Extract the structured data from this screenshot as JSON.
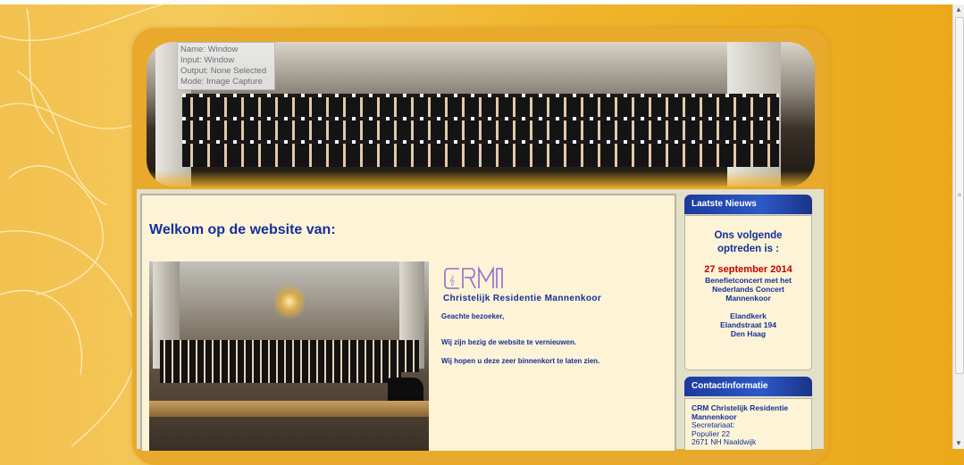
{
  "tooltip": {
    "name": "Name: Window",
    "input": "Input: Window",
    "output": "Output: None Selected",
    "mode": "Mode: Image Capture"
  },
  "main": {
    "welcome": "Welkom op de website van:",
    "org_name": "Christelijk Residentie Mannenkoor",
    "greeting": "Geachte bezoeker,",
    "paragraph_1": "Wij zijn bezig de website te vernieuwen.",
    "paragraph_2": "Wij hopen u deze zeer binnenkort te laten zien."
  },
  "sidebar": {
    "news": {
      "heading": "Laatste Nieuws",
      "title_line1": "Ons volgende",
      "title_line2": "optreden is :",
      "date": "27 september 2014",
      "desc_line1": "Benefietconcert met het",
      "desc_line2": "Nederlands Concert",
      "desc_line3": "Mannenkoor",
      "venue": "Elandkerk",
      "street": "Elandstraat 194",
      "city": "Den Haag"
    },
    "contact": {
      "heading": "Contactinformatie",
      "org_line1": "CRM Christelijk Residentie",
      "org_line2": "Mannenkoor",
      "secretariat": "Secretariaat:",
      "street": "Populier 22",
      "postal": "2671 NH Naaldwijk"
    }
  },
  "colors": {
    "accent_blue": "#15309a",
    "date_red": "#c40000",
    "header_blue": "#1c3a9c",
    "page_gold": "#f0b42a"
  },
  "icons": {
    "scroll_up": "▲",
    "scroll_down": "▼",
    "scroll_grip": "≡"
  }
}
